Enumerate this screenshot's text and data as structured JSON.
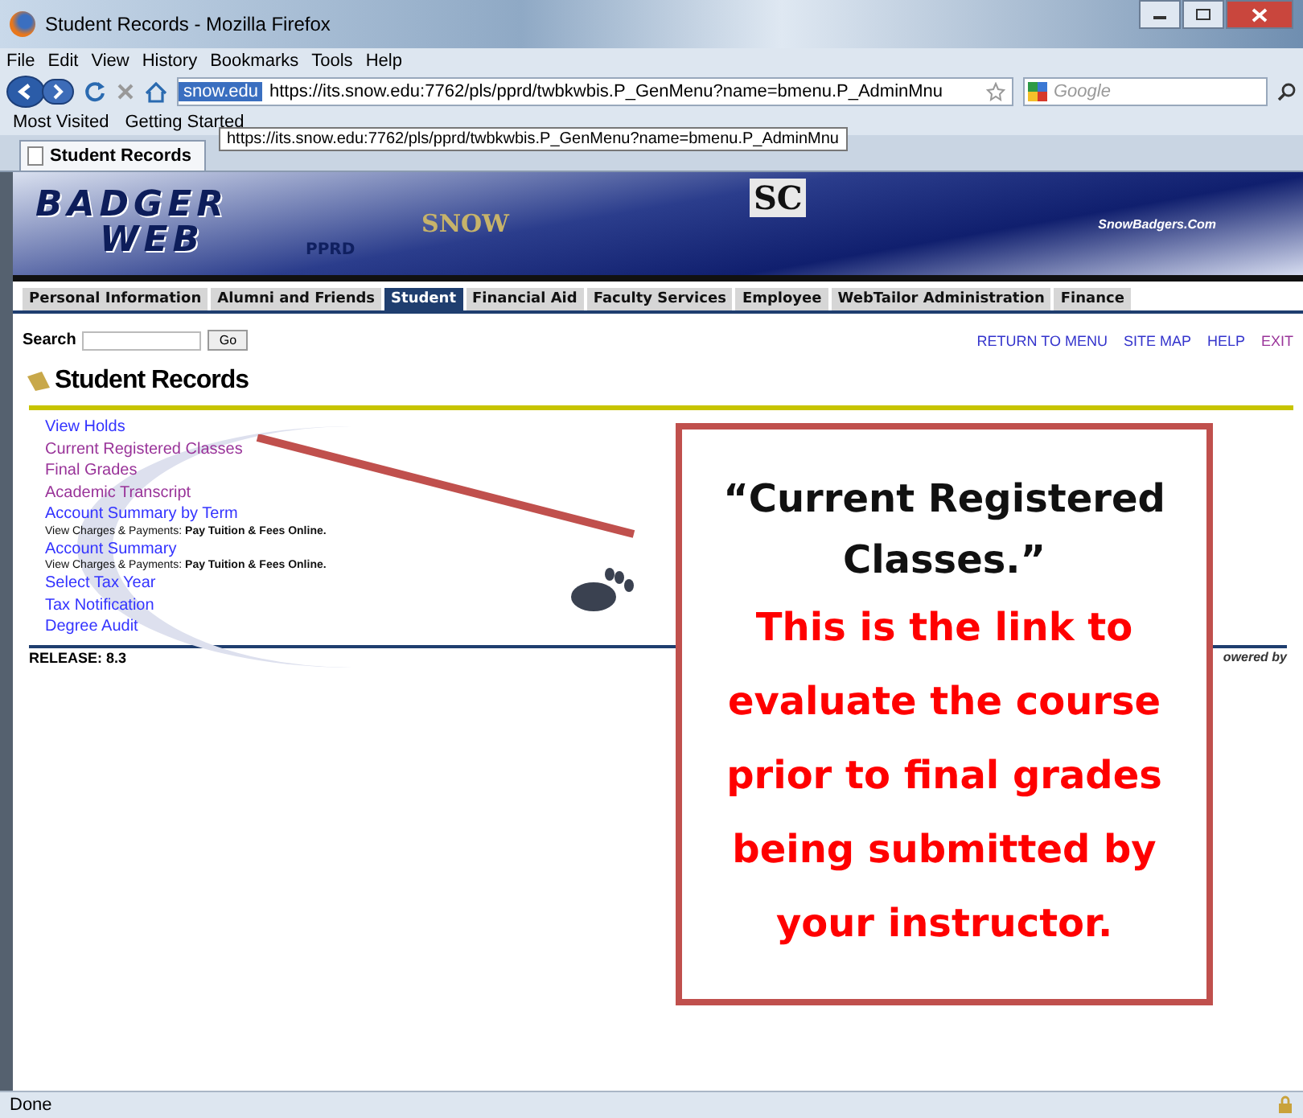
{
  "window": {
    "title": "Student Records - Mozilla Firefox"
  },
  "menu": [
    "File",
    "Edit",
    "View",
    "History",
    "Bookmarks",
    "Tools",
    "Help"
  ],
  "nav": {
    "site": "snow.edu",
    "url": "https://its.snow.edu:7762/pls/pprd/twbkwbis.P_GenMenu?name=bmenu.P_AdminMnu",
    "search_placeholder": "Google"
  },
  "bookmarks": [
    "Most Visited",
    "Getting Started"
  ],
  "tooltip": "https://its.snow.edu:7762/pls/pprd/twbkwbis.P_GenMenu?name=bmenu.P_AdminMnu",
  "browser_tab": "Student Records",
  "banner": {
    "logo_top": "BADGER",
    "logo_bottom": "WEB",
    "logo_tag": "PPRD",
    "snow": "SNOW",
    "sc": "SC",
    "site": "SnowBadgers.Com"
  },
  "tabs": [
    {
      "label": "Personal Information",
      "selected": false
    },
    {
      "label": "Alumni and Friends",
      "selected": false
    },
    {
      "label": "Student",
      "selected": true
    },
    {
      "label": "Financial Aid",
      "selected": false
    },
    {
      "label": "Faculty Services",
      "selected": false
    },
    {
      "label": "Employee",
      "selected": false
    },
    {
      "label": "WebTailor Administration",
      "selected": false
    },
    {
      "label": "Finance",
      "selected": false
    }
  ],
  "search": {
    "label": "Search",
    "button": "Go"
  },
  "top_links": [
    {
      "label": "RETURN TO MENU",
      "visited": false
    },
    {
      "label": "SITE MAP",
      "visited": false
    },
    {
      "label": "HELP",
      "visited": false
    },
    {
      "label": "EXIT",
      "visited": true
    }
  ],
  "page_title": "Student Records",
  "links": [
    {
      "label": "View Holds",
      "visited": false
    },
    {
      "label": "Current Registered Classes",
      "visited": true
    },
    {
      "label": "Final Grades",
      "visited": true
    },
    {
      "label": "Academic Transcript",
      "visited": true
    },
    {
      "label": "Account Summary by Term",
      "visited": false,
      "note": "View Charges & Payments: **Pay Tuition & Fees Online.**"
    },
    {
      "label": "Account Summary",
      "visited": false,
      "note": "View Charges & Payments: **Pay Tuition & Fees Online.**"
    },
    {
      "label": "Select Tax Year",
      "visited": false
    },
    {
      "label": "Tax Notification",
      "visited": false
    },
    {
      "label": "Degree Audit",
      "visited": false
    }
  ],
  "release": "RELEASE: 8.3",
  "powered": "owered by",
  "callout": {
    "heading": "“Current Registered Classes.”",
    "body": "This is the link to evaluate the course prior to final grades being submitted by your instructor."
  },
  "status_bar": "Done"
}
